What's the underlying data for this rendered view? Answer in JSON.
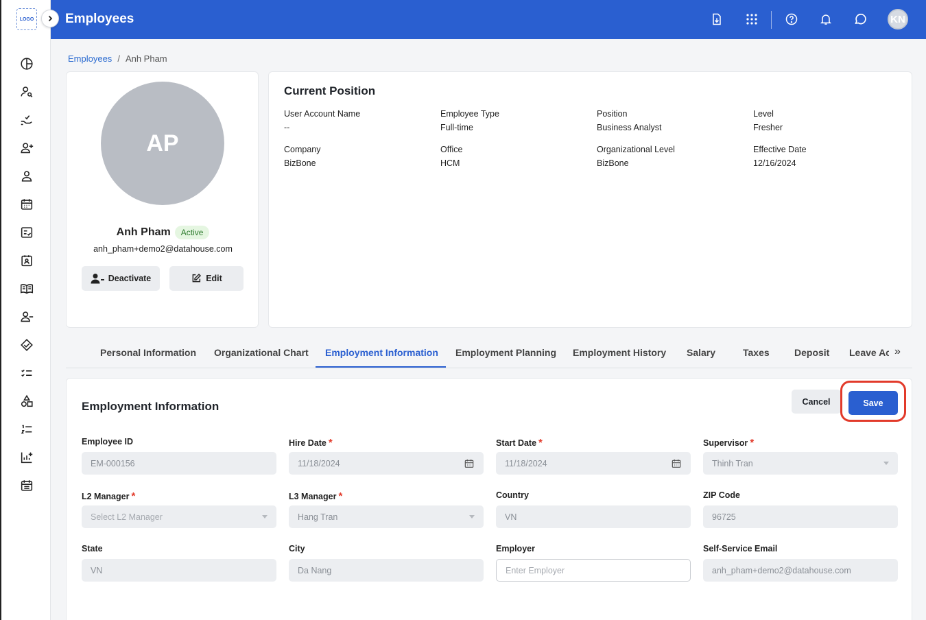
{
  "app": {
    "logo_text": "LOGO",
    "page_title": "Employees",
    "user_initials": "KN"
  },
  "breadcrumb": {
    "root": "Employees",
    "current": "Anh Pham"
  },
  "profile": {
    "initials": "AP",
    "name": "Anh Pham",
    "status": "Active",
    "email": "anh_pham+demo2@datahouse.com",
    "deactivate_label": "Deactivate",
    "edit_label": "Edit"
  },
  "current_position": {
    "title": "Current Position",
    "fields": [
      {
        "label": "User Account Name",
        "value": "--"
      },
      {
        "label": "Employee Type",
        "value": "Full-time"
      },
      {
        "label": "Position",
        "value": "Business Analyst"
      },
      {
        "label": "Level",
        "value": "Fresher"
      },
      {
        "label": "Company",
        "value": "BizBone"
      },
      {
        "label": "Office",
        "value": "HCM"
      },
      {
        "label": "Organizational Level",
        "value": "BizBone"
      },
      {
        "label": "Effective Date",
        "value": "12/16/2024"
      }
    ]
  },
  "tabs": [
    {
      "label": "Personal Information"
    },
    {
      "label": "Organizational Chart"
    },
    {
      "label": "Employment Information",
      "active": true
    },
    {
      "label": "Employment Planning"
    },
    {
      "label": "Employment History"
    },
    {
      "label": "Salary"
    },
    {
      "label": "Taxes"
    },
    {
      "label": "Deposit"
    },
    {
      "label": "Leave Ac"
    }
  ],
  "tab_more": "»",
  "form": {
    "title": "Employment Information",
    "cancel_label": "Cancel",
    "save_label": "Save",
    "fields": [
      {
        "label": "Employee ID",
        "value": "EM-000156"
      },
      {
        "label": "Hire Date",
        "value": "11/18/2024"
      },
      {
        "label": "Start Date",
        "value": "11/18/2024"
      },
      {
        "label": "Supervisor",
        "value": "Thinh Tran"
      },
      {
        "label": "L2 Manager",
        "placeholder": "Select L2 Manager"
      },
      {
        "label": "L3 Manager",
        "value": "Hang Tran"
      },
      {
        "label": "Country",
        "value": "VN"
      },
      {
        "label": "ZIP Code",
        "value": "96725"
      },
      {
        "label": "State",
        "value": "VN"
      },
      {
        "label": "City",
        "value": "Da Nang"
      },
      {
        "label": "Employer",
        "placeholder": "Enter Employer"
      },
      {
        "label": "Self-Service Email",
        "value": "anh_pham+demo2@datahouse.com"
      }
    ]
  },
  "colors": {
    "primary": "#2a5fd0",
    "highlight": "#e23a2a",
    "active_badge_bg": "#e5f6e1"
  }
}
